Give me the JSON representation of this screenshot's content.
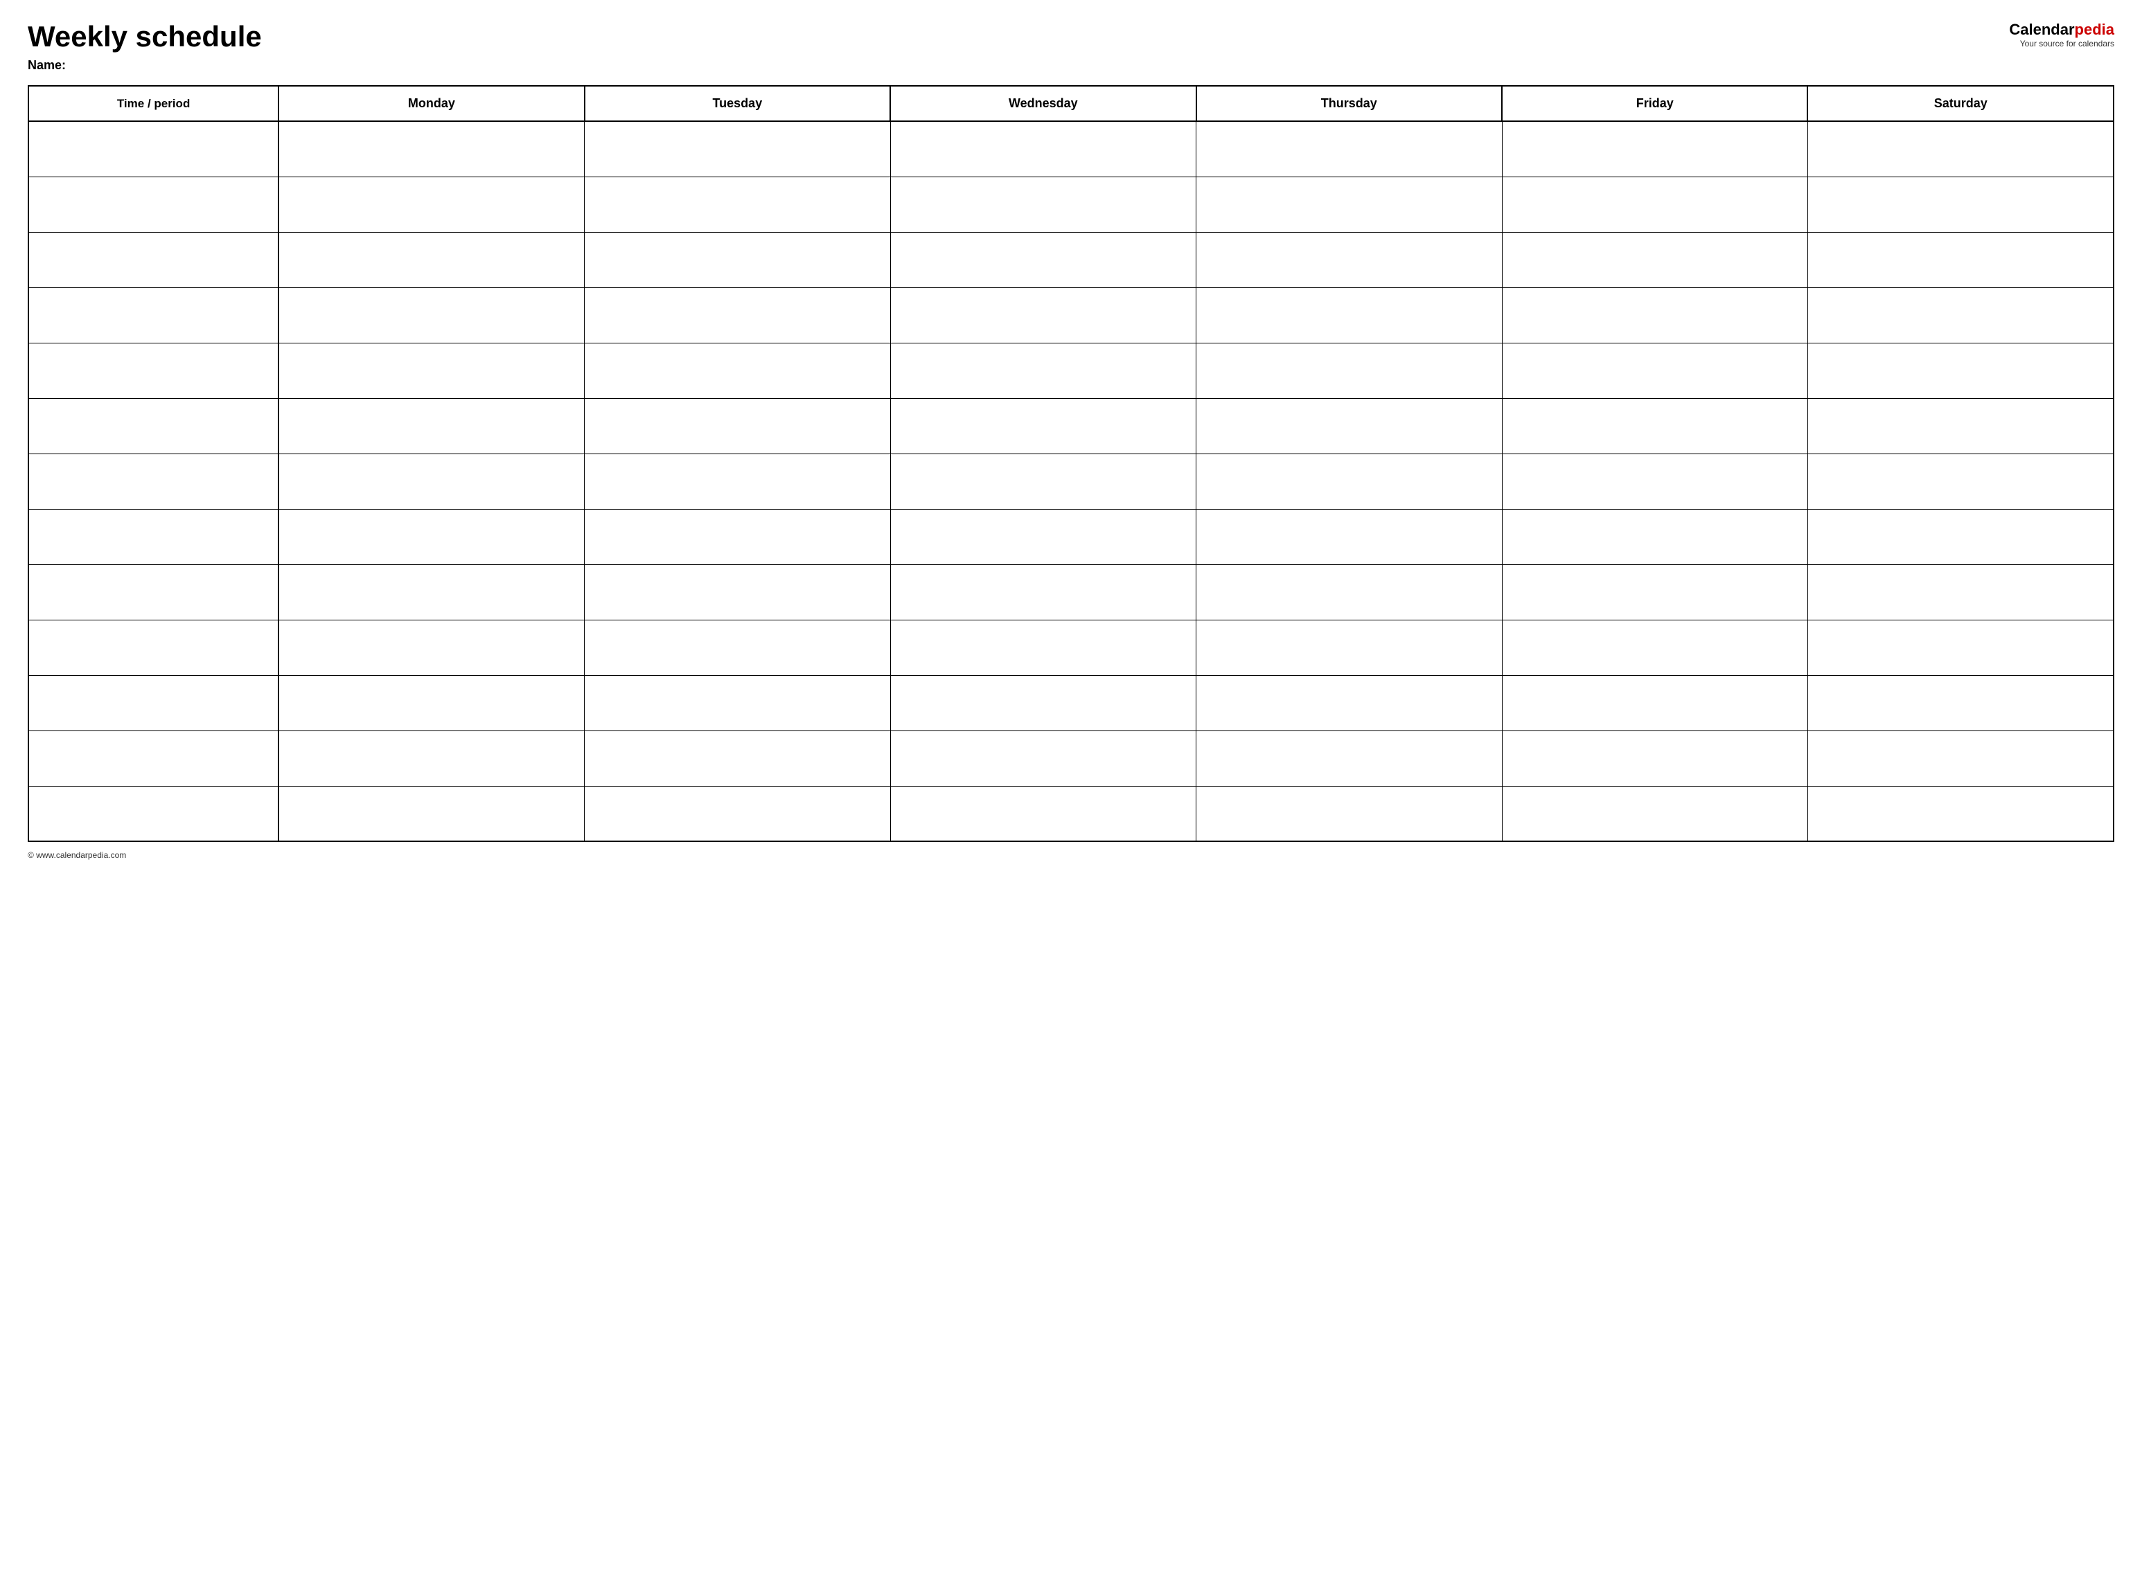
{
  "header": {
    "title": "Weekly schedule",
    "name_label": "Name:",
    "logo_calendar": "Calendar",
    "logo_pedia": "pedia",
    "logo_tagline": "Your source for calendars"
  },
  "table": {
    "columns": [
      {
        "id": "time",
        "label": "Time / period"
      },
      {
        "id": "monday",
        "label": "Monday"
      },
      {
        "id": "tuesday",
        "label": "Tuesday"
      },
      {
        "id": "wednesday",
        "label": "Wednesday"
      },
      {
        "id": "thursday",
        "label": "Thursday"
      },
      {
        "id": "friday",
        "label": "Friday"
      },
      {
        "id": "saturday",
        "label": "Saturday"
      }
    ],
    "row_count": 13
  },
  "footer": {
    "url": "© www.calendarpedia.com"
  }
}
